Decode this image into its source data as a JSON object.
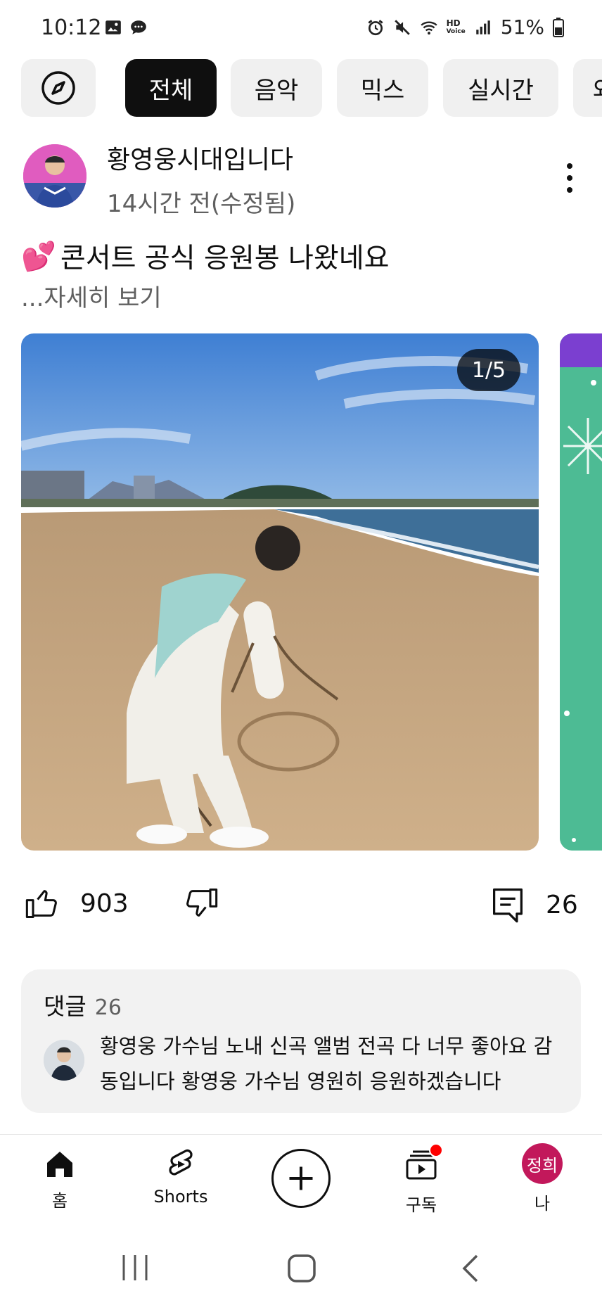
{
  "status_bar": {
    "time": "10:12",
    "battery": "51%",
    "icons": [
      "gallery-icon",
      "chat-icon",
      "alarm-icon",
      "mute-icon",
      "wifi-icon",
      "hd-voice-icon",
      "signal-icon",
      "battery-icon"
    ],
    "hd_label_top": "HD",
    "hd_label_bottom": "Voice"
  },
  "chips": [
    {
      "label": "",
      "icon": "explore-icon"
    },
    {
      "label": "전체",
      "active": true
    },
    {
      "label": "음악"
    },
    {
      "label": "믹스"
    },
    {
      "label": "실시간"
    },
    {
      "label": "와"
    }
  ],
  "post": {
    "channel_name": "황영웅시대입니다",
    "time": "14시간 전(수정됨)",
    "emoji": "💕",
    "text": "콘서트 공식 응원봉 나왔네요",
    "read_more": "...자세히 보기",
    "image_counter": "1/5",
    "colors": {
      "sky": "#4a86d6",
      "sand": "#c9a77c",
      "sea": "#3d6f96",
      "next_card": "#4dbb94"
    }
  },
  "actions": {
    "likes": "903",
    "comments": "26"
  },
  "comments_section": {
    "title": "댓글",
    "count": "26",
    "top_comment": "황영웅 가수님 노내 신곡 앨범 전곡 다 너무 좋아요 감동입니다 황영웅 가수님 영원히 응원하겠습니다"
  },
  "bottom_nav": {
    "home": "홈",
    "shorts": "Shorts",
    "subscriptions": "구독",
    "me": "나",
    "me_avatar": "정희"
  }
}
